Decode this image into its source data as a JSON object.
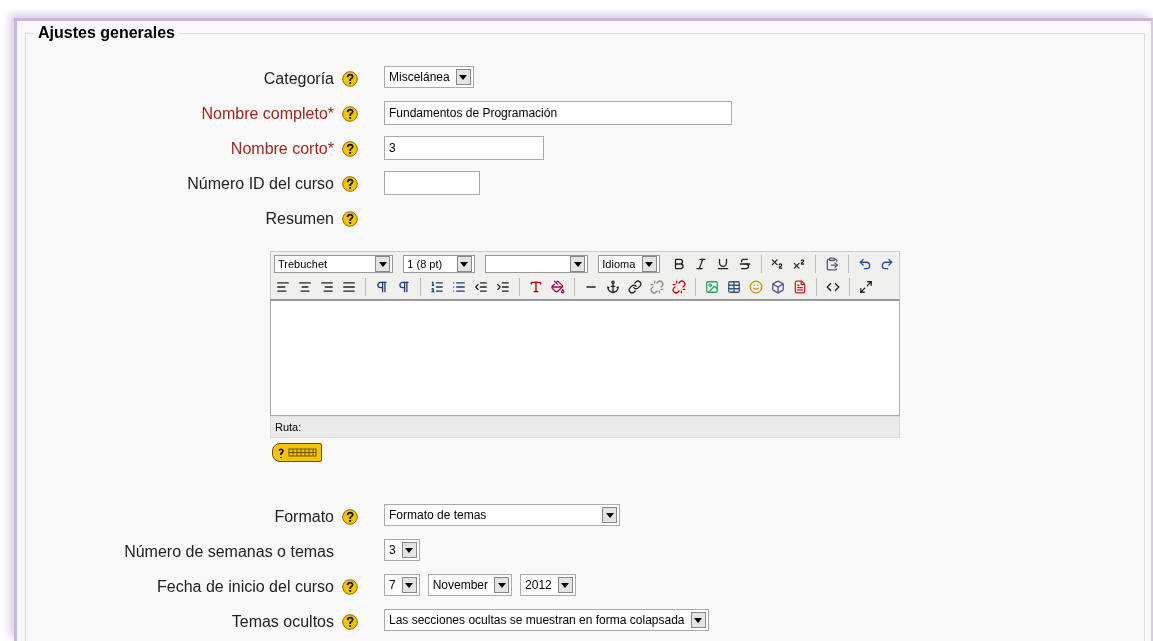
{
  "section": {
    "legend": "Ajustes generales"
  },
  "rows": [
    {
      "kind": "select",
      "label": "Categoría",
      "required": false,
      "help": true,
      "value": "Miscelánea"
    },
    {
      "kind": "text",
      "label": "Nombre completo*",
      "required": true,
      "help": true,
      "value": "Fundamentos de Programación"
    },
    {
      "kind": "text",
      "label": "Nombre corto*",
      "required": true,
      "help": true,
      "value": "3"
    },
    {
      "kind": "text",
      "label": "Número ID del curso",
      "required": false,
      "help": true,
      "value": ""
    },
    {
      "kind": "editor",
      "label": "Resumen",
      "required": false,
      "help": true,
      "font": "Trebuchet",
      "size": "1 (8 pt)",
      "language": "Idioma",
      "path_label": "Ruta:"
    },
    {
      "kind": "select",
      "label": "Formato",
      "required": false,
      "help": true,
      "value": "Formato de temas"
    },
    {
      "kind": "select",
      "label": "Número de semanas o temas",
      "required": false,
      "help": false,
      "value": "3"
    },
    {
      "kind": "date",
      "label": "Fecha de inicio del curso",
      "required": false,
      "help": true,
      "day": "7",
      "month": "November",
      "year": "2012"
    },
    {
      "kind": "select",
      "label": "Temas ocultos",
      "required": false,
      "help": true,
      "value": "Las secciones ocultas se muestran en forma colapsada"
    }
  ]
}
